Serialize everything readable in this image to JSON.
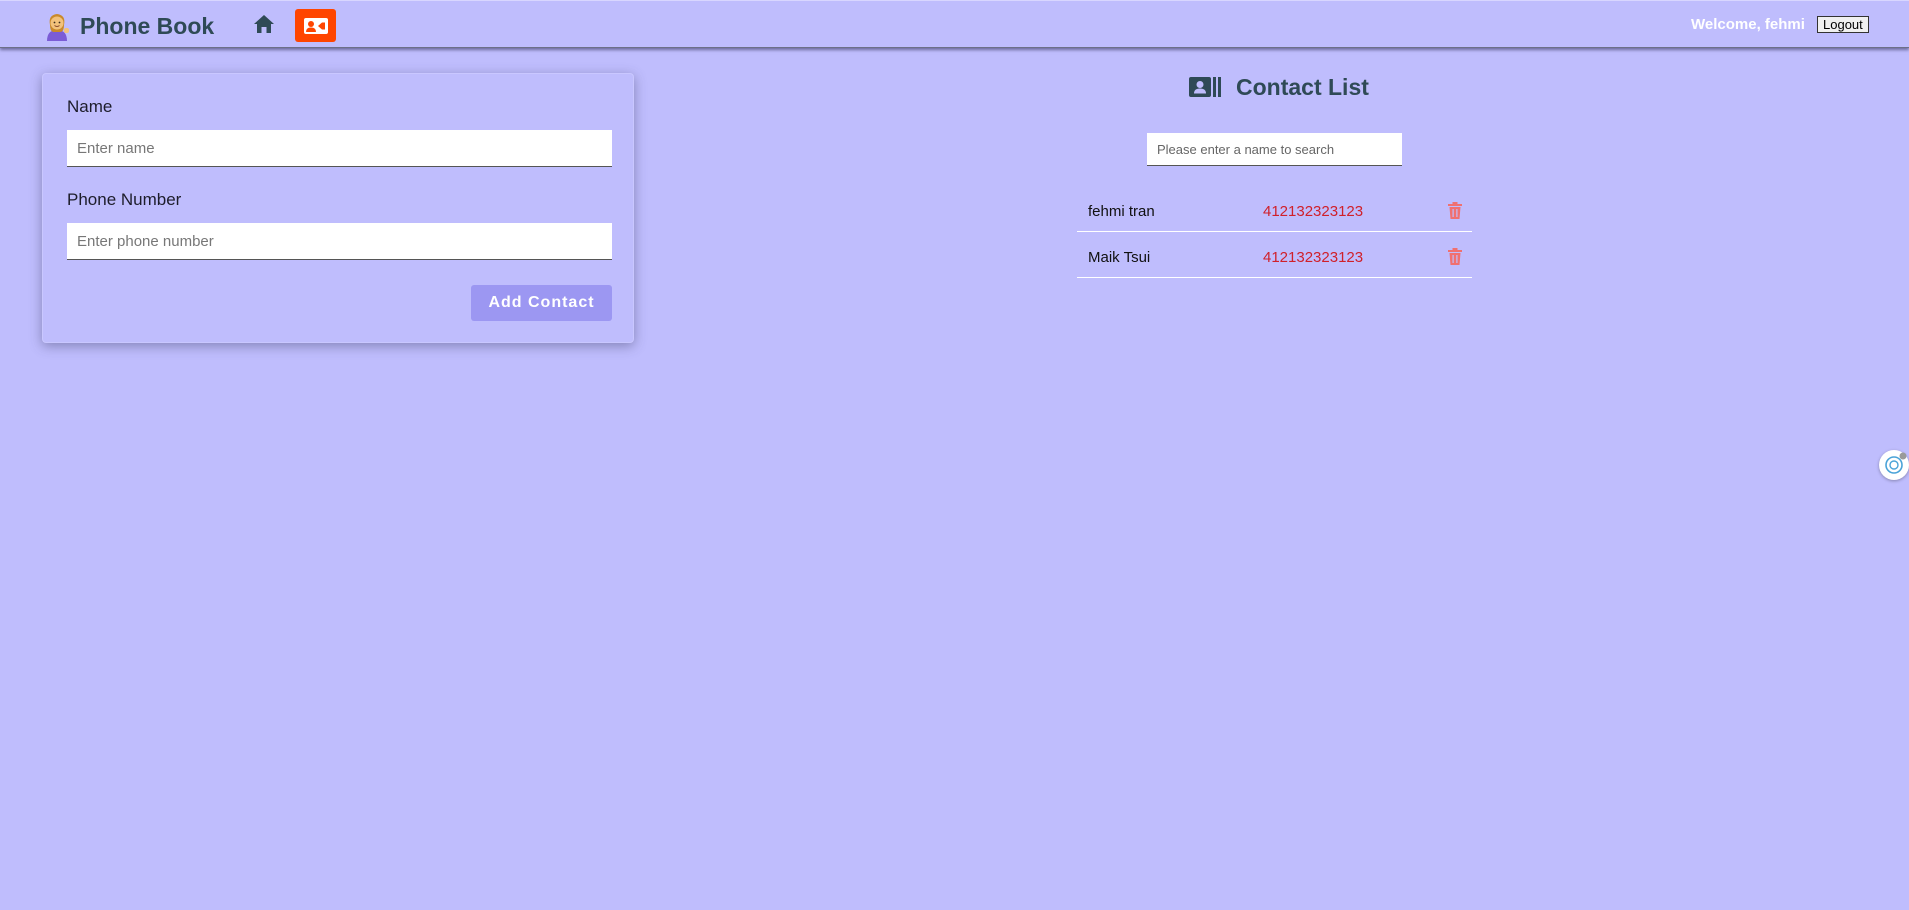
{
  "header": {
    "app_title": "Phone Book",
    "welcome_text": "Welcome, fehmi",
    "logout_label": "Logout",
    "nav_contacts_color": "#ff4500"
  },
  "form": {
    "name_label": "Name",
    "name_placeholder": "Enter name",
    "name_value": "",
    "phone_label": "Phone Number",
    "phone_placeholder": "Enter phone number",
    "phone_value": "",
    "submit_label": "Add Contact"
  },
  "contacts": {
    "heading": "Contact List",
    "search_placeholder": "Please enter a name to search",
    "search_value": "",
    "rows": [
      {
        "name": "fehmi tran",
        "phone": "412132323123"
      },
      {
        "name": "Maik Tsui",
        "phone": "412132323123"
      }
    ]
  },
  "icons": {
    "brand": "person-tipping-hand-icon",
    "home": "home-icon",
    "contacts_nav": "contact-card-icon",
    "heading": "address-book-icon",
    "delete": "trash-icon",
    "side_widget": "assistant-widget-icon"
  },
  "colors": {
    "background": "#bfbdfd",
    "accent_button": "#9c97f2",
    "phone_text": "#d0202a",
    "delete_icon": "#f07070",
    "heading_text": "#2f4a56"
  }
}
